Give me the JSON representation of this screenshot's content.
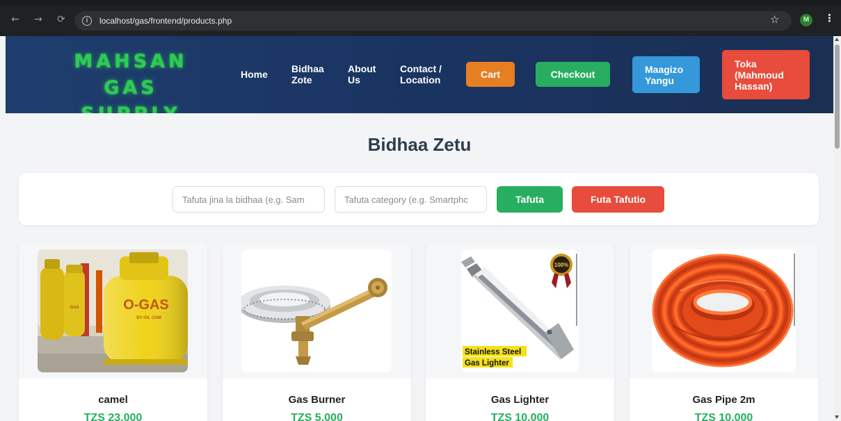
{
  "browser": {
    "url": "localhost/gas/frontend/products.php",
    "profile_initial": "M"
  },
  "header": {
    "logo_line1": "MAHSAN GAS",
    "logo_line2": "SUPPLY",
    "nav": {
      "home": "Home",
      "bidhaa_line1": "Bidhaa",
      "bidhaa_line2": "Zote",
      "about_line1": "About",
      "about_line2": "Us",
      "contact_line1": "Contact /",
      "contact_line2": "Location"
    },
    "buttons": {
      "cart": "Cart",
      "checkout": "Checkout",
      "orders_line1": "Maagizo",
      "orders_line2": "Yangu",
      "logout_line1": "Toka",
      "logout_line2": "(Mahmoud",
      "logout_line3": "Hassan)"
    },
    "colors": {
      "logo": "#2ecc52",
      "cart": "#e67e22",
      "checkout": "#27ae60",
      "orders": "#3498db",
      "logout": "#e74c3c"
    }
  },
  "main": {
    "title": "Bidhaa Zetu",
    "search": {
      "name_placeholder": "Tafuta jina la bidhaa (e.g. Sam",
      "category_placeholder": "Tafuta category (e.g. Smartphc",
      "search_button": "Tafuta",
      "clear_button": "Futa Tafutio"
    },
    "products": [
      {
        "name": "camel",
        "price": "TZS 23,000"
      },
      {
        "name": "Gas Burner",
        "price": "TZS 5,000"
      },
      {
        "name": "Gas Lighter",
        "price": "TZS 10,000"
      },
      {
        "name": "Gas Pipe 2m",
        "price": "TZS 10,000"
      }
    ],
    "image_text": {
      "cylinder_brand": "O-GAS",
      "cylinder_sub": "BY OIL COM",
      "cylinder_small": "GAS",
      "lighter_line1": "Stainless Steel",
      "lighter_line2": "Gas Lighter",
      "badge": "100%"
    }
  }
}
